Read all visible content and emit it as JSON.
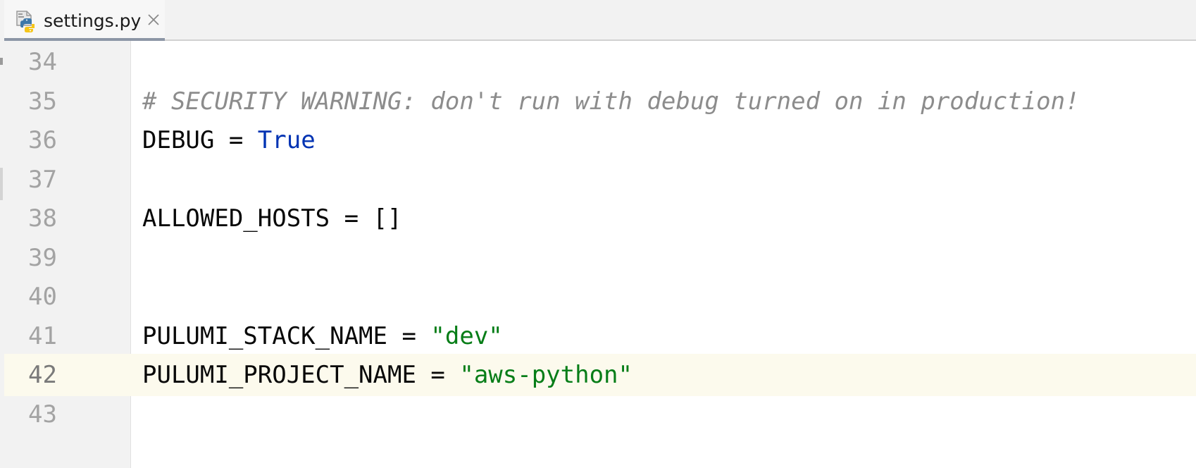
{
  "tab": {
    "filename": "settings.py",
    "icon": "python-file-icon",
    "close": "close-icon"
  },
  "colors": {
    "comment": "#8c8c8c",
    "keyword": "#0033b3",
    "string": "#067d17",
    "current_line_bg": "#fcfaed",
    "gutter_bg": "#f2f2f2"
  },
  "editor": {
    "current_line": 42,
    "lines": [
      {
        "number": "34",
        "tokens": []
      },
      {
        "number": "35",
        "tokens": [
          {
            "type": "comment",
            "text": "# SECURITY WARNING: don't run with debug turned on in production!"
          }
        ]
      },
      {
        "number": "36",
        "tokens": [
          {
            "type": "ident",
            "text": "DEBUG"
          },
          {
            "type": "op",
            "text": " = "
          },
          {
            "type": "keyword",
            "text": "True"
          }
        ]
      },
      {
        "number": "37",
        "tokens": []
      },
      {
        "number": "38",
        "tokens": [
          {
            "type": "ident",
            "text": "ALLOWED_HOSTS"
          },
          {
            "type": "op",
            "text": " = "
          },
          {
            "type": "op",
            "text": "[]"
          }
        ]
      },
      {
        "number": "39",
        "tokens": []
      },
      {
        "number": "40",
        "tokens": []
      },
      {
        "number": "41",
        "tokens": [
          {
            "type": "ident",
            "text": "PULUMI_STACK_NAME"
          },
          {
            "type": "op",
            "text": " = "
          },
          {
            "type": "string",
            "text": "\"dev\""
          }
        ]
      },
      {
        "number": "42",
        "tokens": [
          {
            "type": "ident",
            "text": "PULUMI_PROJECT_NAME"
          },
          {
            "type": "op",
            "text": " = "
          },
          {
            "type": "string",
            "text": "\"aws-python\""
          }
        ]
      },
      {
        "number": "43",
        "tokens": []
      }
    ]
  }
}
